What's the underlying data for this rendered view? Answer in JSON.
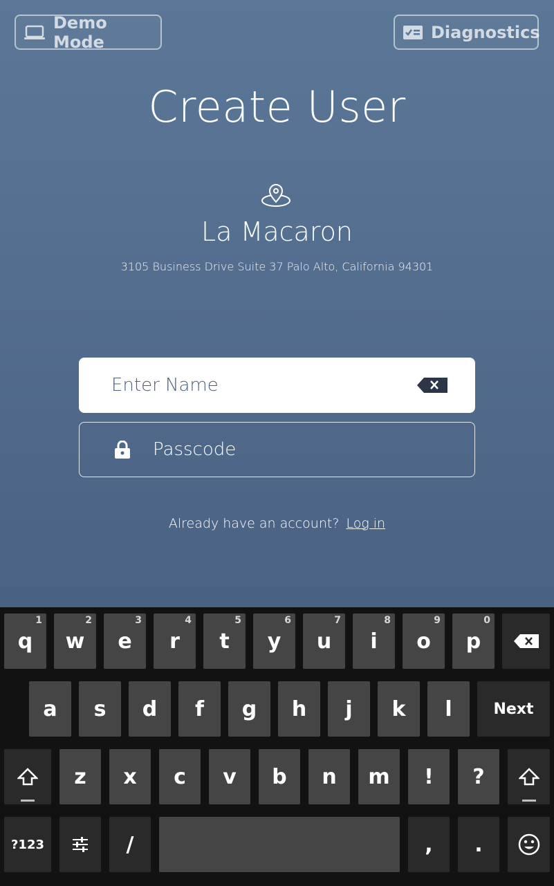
{
  "header": {
    "demo_label": "Demo Mode",
    "diagnostics_label": "Diagnostics"
  },
  "title": "Create User",
  "store": {
    "name": "La Macaron",
    "address": "3105 Business Drive Suite 37 Palo Alto, California 94301"
  },
  "form": {
    "name_placeholder": "Enter Name",
    "passcode_placeholder": "Passcode"
  },
  "account": {
    "prompt": "Already have an account?",
    "login_link": "Log in"
  },
  "keyboard": {
    "row1": [
      {
        "label": "q",
        "hint": "1"
      },
      {
        "label": "w",
        "hint": "2"
      },
      {
        "label": "e",
        "hint": "3"
      },
      {
        "label": "r",
        "hint": "4"
      },
      {
        "label": "t",
        "hint": "5"
      },
      {
        "label": "y",
        "hint": "6"
      },
      {
        "label": "u",
        "hint": "7"
      },
      {
        "label": "i",
        "hint": "8"
      },
      {
        "label": "o",
        "hint": "9"
      },
      {
        "label": "p",
        "hint": "0"
      }
    ],
    "row2": [
      "a",
      "s",
      "d",
      "f",
      "g",
      "h",
      "j",
      "k",
      "l"
    ],
    "row3": [
      "z",
      "x",
      "c",
      "v",
      "b",
      "n",
      "m",
      "!",
      "?"
    ],
    "next_label": "Next",
    "symbols_label": "?123",
    "slash_label": "/",
    "comma_label": ",",
    "period_label": "."
  },
  "icons": {
    "demo": "laptop-icon",
    "diagnostics": "checklist-icon",
    "location": "location-pin-icon",
    "clear": "backspace-icon",
    "lock": "lock-icon",
    "shift": "shift-icon",
    "settings": "sliders-icon",
    "emoji": "smiley-icon"
  }
}
